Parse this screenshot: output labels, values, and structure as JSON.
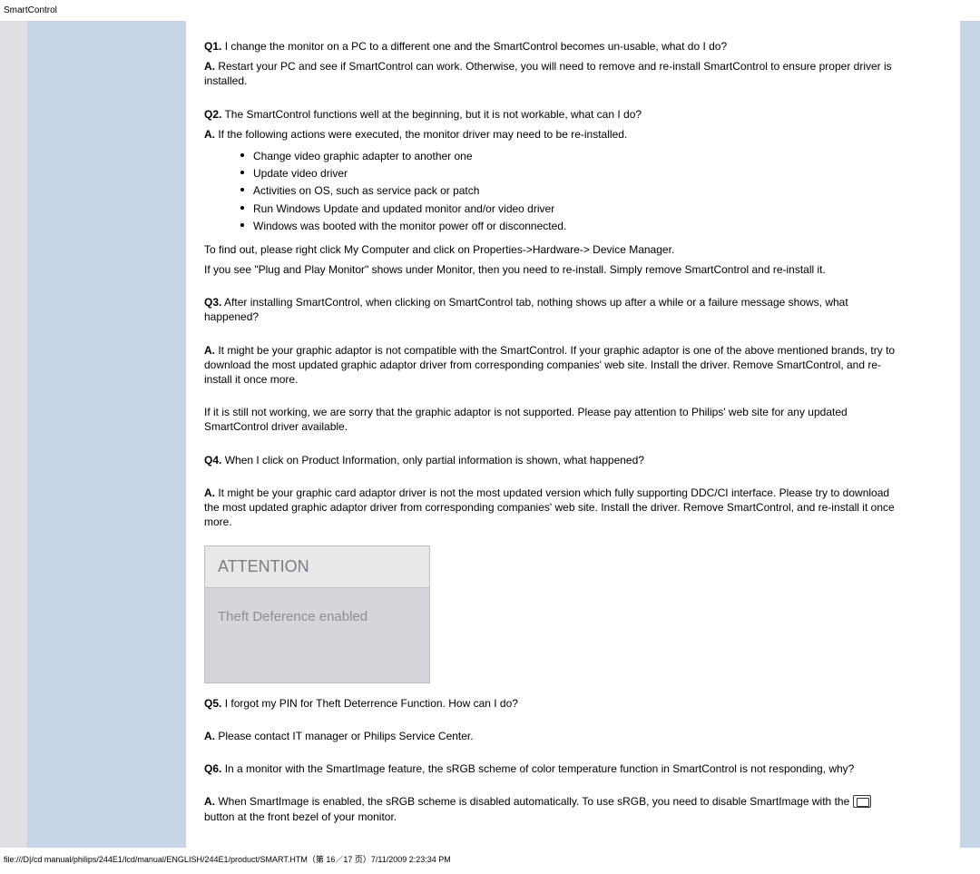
{
  "header": "SmartControl",
  "faqs": [
    {
      "q": "Q1.",
      "qt": "I change the monitor on a PC to a different one and the SmartControl becomes un-usable, what do I do?",
      "a": "A.",
      "at": "Restart your PC and see if SmartControl can work. Otherwise, you will need to remove and re-install SmartControl to ensure proper driver is installed."
    },
    {
      "q": "Q2.",
      "qt": "The SmartControl functions well at the beginning, but it is not workable, what can I do?",
      "a": "A.",
      "at": "If the following actions were executed, the monitor driver may need to be re-installed."
    }
  ],
  "bullets": [
    "Change video graphic adapter to another one",
    "Update video driver",
    "Activities on OS, such as service pack or patch",
    "Run Windows Update and updated monitor and/or video driver",
    "Windows was booted with the monitor power off or disconnected."
  ],
  "p_findout1": "To find out, please right click My Computer and click on Properties->Hardware-> Device Manager.",
  "p_findout2": "If you see \"Plug and Play Monitor\" shows under Monitor, then you need to re-install. Simply remove SmartControl and re-install it.",
  "q3": {
    "q": "Q3.",
    "qt": "After installing SmartControl, when clicking on SmartControl tab, nothing shows up after a while or a failure message shows, what happened?",
    "a": "A.",
    "at": "It might be your graphic adaptor is not compatible with the SmartControl. If your graphic adaptor is one of the above mentioned brands, try to download the most updated graphic adaptor driver from corresponding companies' web site. Install the driver. Remove SmartControl, and re-install it once more."
  },
  "q3extra": "If it is still not working, we are sorry that the graphic adaptor is not supported. Please pay attention to Philips' web site for any updated SmartControl driver available.",
  "q4": {
    "q": "Q4.",
    "qt": "When I click on Product Information, only partial information is shown, what happened?",
    "a": "A.",
    "at": "It might be your graphic card adaptor driver is not the most updated version which fully supporting DDC/CI interface. Please try to download the most updated graphic adaptor driver from corresponding companies' web site. Install the driver. Remove SmartControl, and re-install it once more."
  },
  "attention": {
    "title": "ATTENTION",
    "body": "Theft Deference enabled"
  },
  "q5": {
    "q": "Q5.",
    "qt": "I forgot my PIN for Theft Deterrence Function. How can I do?",
    "a": "A.",
    "at": "Please contact IT manager or Philips Service Center."
  },
  "q6": {
    "q": "Q6.",
    "qt": "In a monitor with the SmartImage feature, the sRGB scheme of color temperature function in SmartControl is not responding, why?",
    "a": "A.",
    "at1": "When SmartImage is enabled, the sRGB scheme is disabled automatically. To use sRGB, you need to disable SmartImage with the ",
    "at2": " button at the front bezel of your monitor."
  },
  "footer": "file:///D|/cd manual/philips/244E1/lcd/manual/ENGLISH/244E1/product/SMART.HTM（第 16／17 页）7/11/2009 2:23:34 PM"
}
